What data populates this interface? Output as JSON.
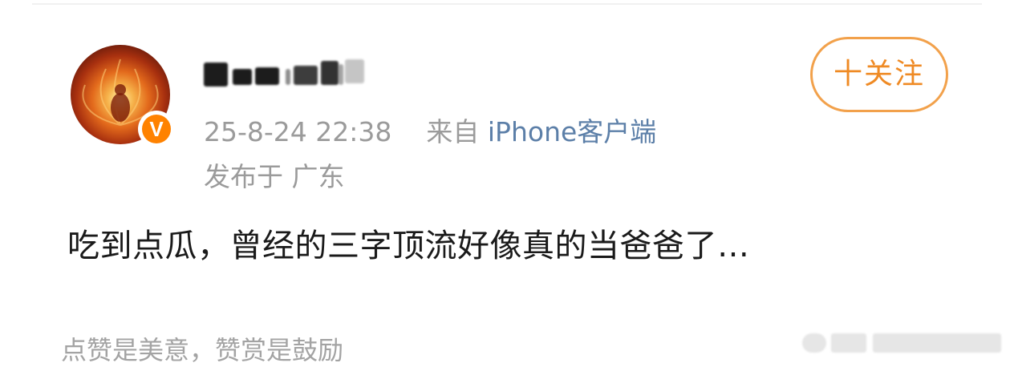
{
  "post": {
    "author": {
      "avatar_icon": "flame-avatar",
      "verified_badge": "V",
      "name_blurred": true
    },
    "follow_label": "十关注",
    "timestamp": "25-8-24 22:38",
    "source_prefix": "来自",
    "source_client": "iPhone客户端",
    "location": "发布于 广东",
    "content": "吃到点瓜，曾经的三字顶流好像真的当爸爸了…"
  },
  "footer": {
    "reward_prompt": "点赞是美意，赞赏是鼓励"
  },
  "colors": {
    "accent_orange": "#ef8a24",
    "link_blue": "#5c7fa8",
    "meta_gray": "#9b9b9b",
    "text_dark": "#1a1a1a"
  }
}
